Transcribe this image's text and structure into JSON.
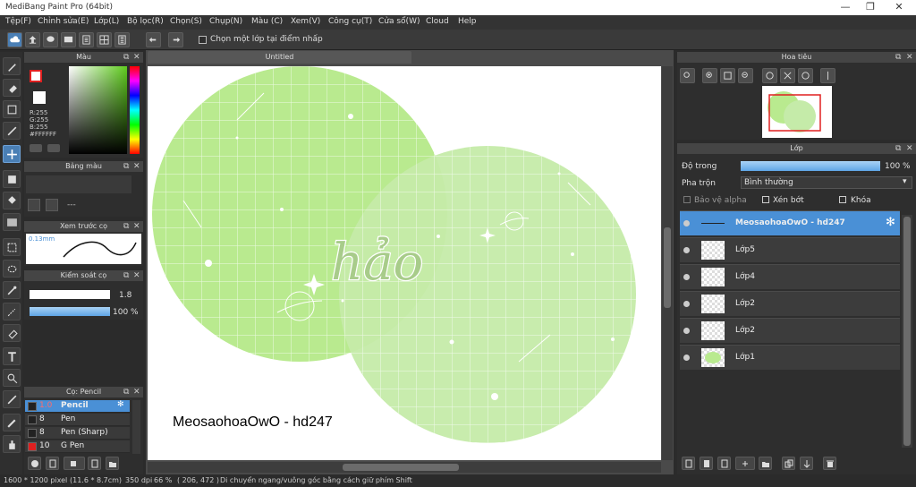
{
  "window": {
    "title": "MediBang Paint Pro (64bit)"
  },
  "menu": [
    "Tệp(F)",
    "Chỉnh sửa(E)",
    "Lớp(L)",
    "Bộ lọc(R)",
    "Chọn(S)",
    "Chụp(N)",
    "Màu (C)",
    "Xem(V)",
    "Công cụ(T)",
    "Cửa sổ(W)",
    "Cloud",
    "Help"
  ],
  "toolbar": {
    "checkbox_label": "Chọn một lớp tại điểm nhấp"
  },
  "color_panel": {
    "title": "Màu",
    "r": "R:255",
    "g": "G:255",
    "b": "B:255",
    "hex": "#FFFFFF"
  },
  "palette_panel": {
    "title": "Bảng màu",
    "value": "---"
  },
  "brush_preview": {
    "title": "Xem trước cọ",
    "size": "0.13mm"
  },
  "brush_control": {
    "title": "Kiểm soát cọ",
    "size": "1.8",
    "opacity": "100 %",
    "opacity_fraction": 1.0
  },
  "brush_panel": {
    "title": "Cọ: Pencil",
    "items": [
      {
        "size": "1.0",
        "name": "Pencil",
        "selected": true,
        "swatch": "#222222"
      },
      {
        "size": "8",
        "name": "Pen",
        "selected": false,
        "swatch": "#222222"
      },
      {
        "size": "8",
        "name": "Pen (Sharp)",
        "selected": false,
        "swatch": "#222222"
      },
      {
        "size": "10",
        "name": "G Pen",
        "selected": false,
        "swatch": "#e02020"
      }
    ]
  },
  "document": {
    "tab": "Untitled",
    "watermark": "MeosaohoaOwO - hd247",
    "center_text": "hảo"
  },
  "navigator": {
    "title": "Hoa tiêu"
  },
  "layer_panel": {
    "title": "Lớp",
    "opacity_label": "Độ trong",
    "opacity_value": "100 %",
    "opacity_fraction": 1.0,
    "blend_label": "Pha trộn",
    "blend_value": "Bình thường",
    "protect_alpha": "Bảo vệ alpha",
    "clipping": "Xén bớt",
    "lock": "Khóa",
    "layers": [
      {
        "name": "MeosaohoaOwO - hd247",
        "selected": true
      },
      {
        "name": "Lớp5",
        "selected": false
      },
      {
        "name": "Lớp4",
        "selected": false
      },
      {
        "name": "Lớp2",
        "selected": false
      },
      {
        "name": "Lớp2",
        "selected": false
      },
      {
        "name": "Lớp1",
        "selected": false
      }
    ]
  },
  "status": {
    "size": "1600 * 1200 pixel",
    "physical": "(11.6 * 8.7cm)",
    "dpi": "350 dpi",
    "zoom": "66 %",
    "coords": "( 206, 472 )",
    "hint": "Di chuyển ngang/vuông góc bằng cách giữ phím Shift"
  },
  "colors": {
    "accent": "#4a90d6",
    "green1": "#b9ea8f",
    "green2": "#c5eba9"
  }
}
